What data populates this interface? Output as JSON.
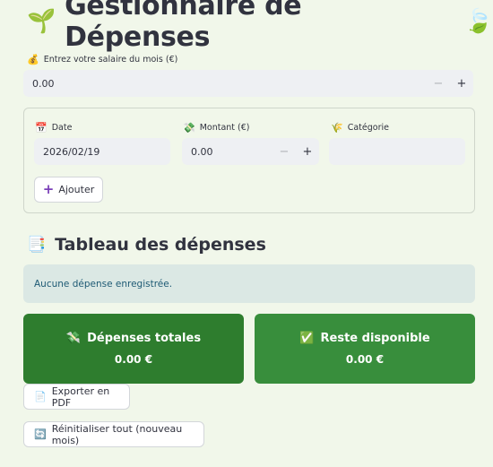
{
  "header": {
    "title": "Gestionnaire de Dépenses",
    "icon_left": "🌱",
    "icon_right": "🍃"
  },
  "salary": {
    "icon": "💰",
    "label": "Entrez votre salaire du mois (€)",
    "value": "0.00",
    "minus": "−",
    "plus": "+"
  },
  "form": {
    "date": {
      "icon": "📅",
      "label": "Date",
      "value": "2026/02/19"
    },
    "amount": {
      "icon": "💸",
      "label": "Montant (€)",
      "value": "0.00",
      "minus": "−",
      "plus": "+"
    },
    "category": {
      "icon": "🌾",
      "label": "Catégorie",
      "value": ""
    },
    "add_button": {
      "icon": "+",
      "label": "Ajouter"
    }
  },
  "expenses_section": {
    "icon": "📑",
    "title": "Tableau des dépenses",
    "empty_message": "Aucune dépense enregistrée."
  },
  "cards": {
    "total": {
      "icon": "💸",
      "title": "Dépenses totales",
      "value": "0.00 €",
      "color": "#2e7d2e"
    },
    "remaining": {
      "icon": "✅",
      "title": "Reste disponible",
      "value": "0.00 €",
      "color": "#388e3c"
    }
  },
  "actions": {
    "export": {
      "icon": "📄",
      "label": "Exporter en PDF"
    },
    "reset": {
      "icon": "🔄",
      "label": "Réinitialiser tout (nouveau mois)"
    }
  }
}
